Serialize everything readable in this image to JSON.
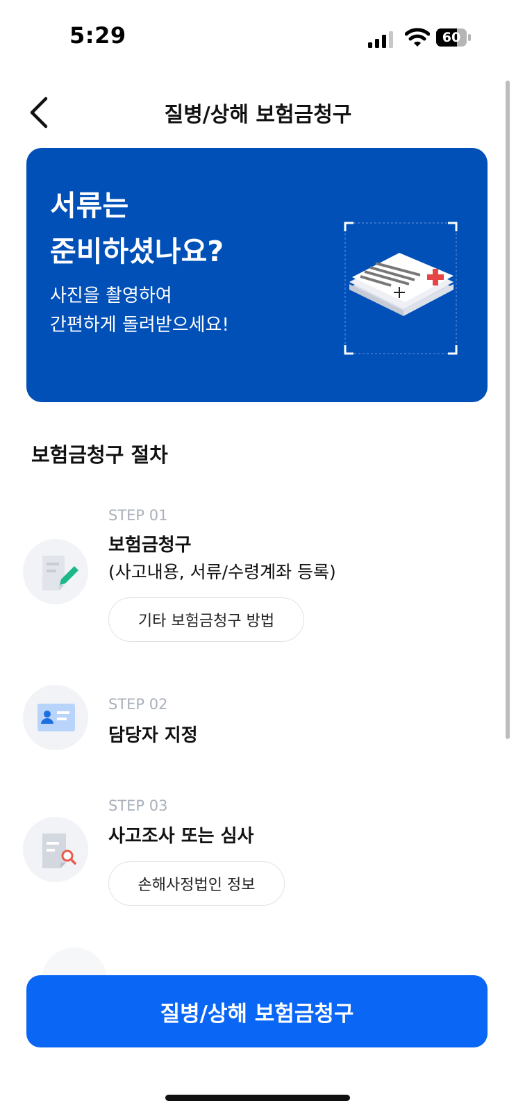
{
  "status_bar": {
    "time": "5:29",
    "battery": "60"
  },
  "header": {
    "title": "질병/상해 보험금청구"
  },
  "banner": {
    "heading": "서류는\n준비하셨나요?",
    "subtext": "사진을 촬영하여\n간편하게 돌려받으세요!"
  },
  "section": {
    "title": "보험금청구 절차"
  },
  "steps": [
    {
      "label": "STEP 01",
      "name": "보험금청구",
      "desc": "(사고내용, 서류/수령계좌 등록)",
      "button": "기타 보험금청구 방법"
    },
    {
      "label": "STEP 02",
      "name": "담당자 지정"
    },
    {
      "label": "STEP 03",
      "name": "사고조사 또는 심사",
      "button": "손해사정법인 정보"
    }
  ],
  "cta": {
    "label": "질병/상해 보험금청구"
  },
  "colors": {
    "banner": "#0050b8",
    "cta": "#0a66f5",
    "step_label": "#a9b0ba"
  },
  "icons": [
    "back-chevron-icon",
    "signal-icon",
    "wifi-icon",
    "battery-icon",
    "document-edit-icon",
    "id-card-icon",
    "document-search-icon",
    "documents-illustration"
  ]
}
